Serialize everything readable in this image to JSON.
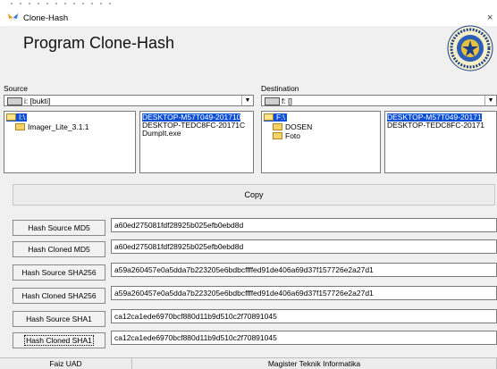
{
  "window": {
    "title": "Clone-Hash",
    "close_glyph": "×",
    "icon": "butterfly-icon"
  },
  "header": {
    "program_title": "Program Clone-Hash",
    "logo": "university-seal-logo"
  },
  "source": {
    "label": "Source",
    "drive_value": "i: [bukti]",
    "folders": [
      {
        "name": "I:\\",
        "selected": true,
        "open": true
      },
      {
        "name": "Imager_Lite_3.1.1",
        "selected": false,
        "open": false
      }
    ],
    "files": [
      {
        "name": "DESKTOP-M57T049-201710",
        "selected": true
      },
      {
        "name": "DESKTOP-TEDC8FC-20171C",
        "selected": false
      },
      {
        "name": "DumpIt.exe",
        "selected": false
      }
    ]
  },
  "destination": {
    "label": "Destination",
    "drive_value": "f: []",
    "folders": [
      {
        "name": "F:\\",
        "selected": true,
        "open": true
      },
      {
        "name": "DOSEN",
        "selected": false,
        "open": false
      },
      {
        "name": "Foto",
        "selected": false,
        "open": false
      }
    ],
    "files": [
      {
        "name": "DESKTOP-M57T049-20171",
        "selected": true
      },
      {
        "name": "DESKTOP-TEDC8FC-20171",
        "selected": false
      }
    ]
  },
  "copy_button": "Copy",
  "hashes": [
    {
      "button": "Hash Source MD5",
      "value": "a60ed275081fdf28925b025efb0ebd8d"
    },
    {
      "button": "Hash Cloned MD5",
      "value": "a60ed275081fdf28925b025efb0ebd8d"
    },
    {
      "button": "Hash Source SHA256",
      "value": "a59a260457e0a5dda7b223205e6bdbcffffed91de406a69d37f157726e2a27d1"
    },
    {
      "button": "Hash Cloned SHA256",
      "value": "a59a260457e0a5dda7b223205e6bdbcffffed91de406a69d37f157726e2a27d1"
    },
    {
      "button": "Hash Source SHA1",
      "value": "ca12ca1ede6970bcf880d11b9d510c2f70891045"
    },
    {
      "button": "Hash Cloned SHA1",
      "value": "ca12ca1ede6970bcf880d11b9d510c2f70891045"
    }
  ],
  "statusbar": {
    "left": "Faiz UAD",
    "right": "Magister Teknik Informatika"
  }
}
